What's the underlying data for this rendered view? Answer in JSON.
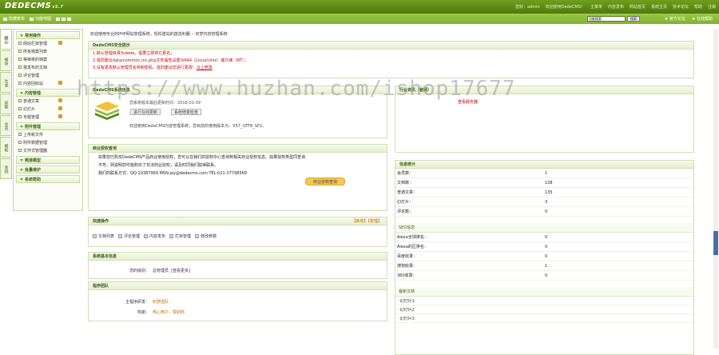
{
  "app": {
    "logo": "DEDECMS",
    "version": "v5.7"
  },
  "top_info": [
    "您好：admin",
    "欢迎使用DedeCMS！",
    "主菜单",
    "内容发布",
    "网站首页",
    "系统主页",
    "技术论坛",
    "帮助",
    "注销"
  ],
  "toolbar": {
    "left": [
      "隐藏菜单",
      "功能地图"
    ],
    "search_placeholder": "功能搜索",
    "search_btn": "搜索",
    "right": [
      "官方论坛",
      "在线帮助"
    ]
  },
  "vtabs": [
    "核心",
    "模块",
    "生成",
    "采集",
    "会员",
    "模板",
    "系统"
  ],
  "sidebar": {
    "sections": [
      {
        "title": "常用操作",
        "items": [
          "网站栏目管理",
          "所有档案列表",
          "等审核的档案",
          "我发布的文档",
          "评论管理",
          "内容回收站"
        ]
      },
      {
        "title": "内容管理",
        "items": [
          "普通文章",
          "幻灯片",
          "专题管理"
        ]
      },
      {
        "title": "附件管理",
        "items": [
          "上传新文件",
          "附件数据管理",
          "文件式管理器"
        ]
      },
      {
        "title": "频道模型",
        "items": []
      },
      {
        "title": "批量维护",
        "items": []
      },
      {
        "title": "系统帮助",
        "items": []
      }
    ]
  },
  "main": {
    "welcome": "欢迎使用专业的PHP网站管理系统，轻松建站的首选利器 -- 织梦内容管理系统",
    "security": {
      "title": "DedeCMS安全提示",
      "lines": [
        "1.默认管理目录为dede，需要立即将它更名；",
        "2.强烈建议data/common.inc.php文件属性设置为644（Linux/Unix）或只读（NT）；",
        "3.没有更改默认管理员名称和密码，强烈建议您进行更改！"
      ],
      "link": "马上修改"
    },
    "version": {
      "title": "DedeCMS系统信息",
      "info": "您系统版本最后更新时间：2018-01-09",
      "btn1": "进行在线更新",
      "btn2": "系统修复检查",
      "text": "欢迎使用DedeCMS内容管理系统，您目前的使用版本为：V57_UTF8_SP2。"
    },
    "notice": {
      "title": "行业资讯（官网）",
      "item": "查看服务器"
    },
    "auth": {
      "title": "商业授权查询",
      "lines": [
        "如果您已购买DedeCMS产品商业使用授权，您可以在我们的授权中心查询到相关商业授权信息。如果授权类型同查询",
        "不符，则说明您可能购买了非法商业授权，请及时同我们取得联系。",
        "我们的联系方式：QQ:10387969  MSN:jay@dedecms.com  TEL:021-37798569"
      ],
      "btn": "商业授权查询"
    },
    "quick": {
      "title": "快捷操作",
      "right": "【新增】【管理】",
      "items": [
        "文档列表",
        "评论管理",
        "内容发布",
        "栏目管理",
        "修改参数"
      ]
    },
    "sysinfo": {
      "title": "系统基本信息",
      "k": "您的级别：",
      "v": "总管理员",
      "link": "[查看更多]"
    },
    "team": {
      "title": "程序团队",
      "rows": [
        {
          "k": "主程序研发：",
          "v": "织梦团队"
        },
        {
          "k": "鸣谢：",
          "v": "热心用户、赞助商"
        }
      ]
    },
    "stats": {
      "title": "信息统计",
      "rows": [
        {
          "k": "会员数：",
          "v": "1"
        },
        {
          "k": "文档数：",
          "v": "138"
        },
        {
          "k": "普通文章：",
          "v": "135"
        },
        {
          "k": "幻灯片：",
          "v": "3"
        },
        {
          "k": "评论数：",
          "v": "0"
        }
      ],
      "seo_title": "SEO信息",
      "seo_rows": [
        {
          "k": "Alexa全球排名：",
          "v": "0"
        },
        {
          "k": "Alexa的区排名：",
          "v": "0"
        },
        {
          "k": "百度收录：",
          "v": "0"
        },
        {
          "k": "搜狗收录：",
          "v": "1"
        },
        {
          "k": "360收录：",
          "v": "0"
        }
      ],
      "news_title": "最新文档",
      "news": [
        "幻灯片1",
        "幻灯片2",
        "幻灯片3"
      ]
    }
  },
  "watermark": "https://www.huzhan.com/ishop17677"
}
